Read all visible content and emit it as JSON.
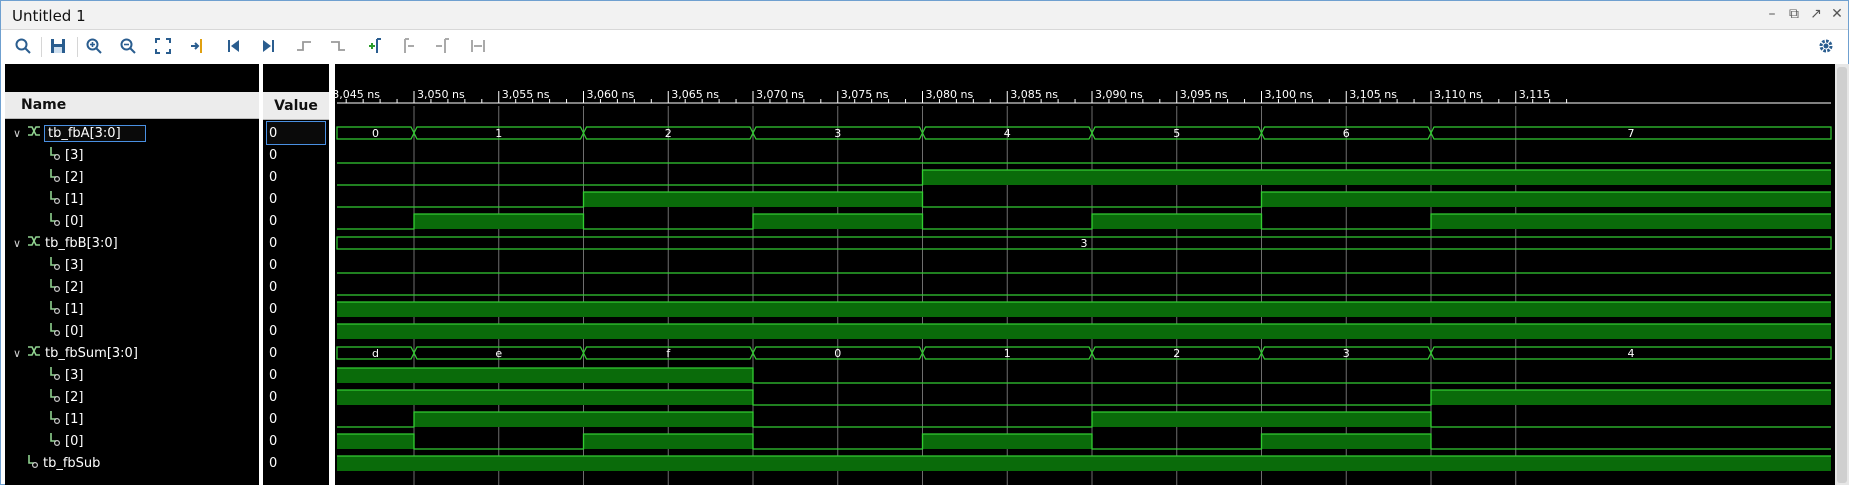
{
  "window": {
    "title": "Untitled 1"
  },
  "toolbar": {
    "icons": [
      "search-icon",
      "save-icon",
      "zoom-in-icon",
      "zoom-out-icon",
      "zoom-fit-icon",
      "go-to-cursor-icon",
      "go-to-start-icon",
      "go-to-end-icon",
      "previous-transition-icon",
      "next-transition-icon",
      "add-marker-icon",
      "previous-marker-icon",
      "next-marker-icon",
      "swap-cursors-icon",
      "settings-icon"
    ]
  },
  "columns": {
    "name": "Name",
    "value": "Value"
  },
  "signals": [
    {
      "label": "tb_fbA[3:0]",
      "type": "bus",
      "expanded": true,
      "indent": 0,
      "value": "0",
      "selected": true
    },
    {
      "label": "[3]",
      "type": "bit",
      "indent": 1,
      "value": "0"
    },
    {
      "label": "[2]",
      "type": "bit",
      "indent": 1,
      "value": "0"
    },
    {
      "label": "[1]",
      "type": "bit",
      "indent": 1,
      "value": "0"
    },
    {
      "label": "[0]",
      "type": "bit",
      "indent": 1,
      "value": "0"
    },
    {
      "label": "tb_fbB[3:0]",
      "type": "bus",
      "expanded": true,
      "indent": 0,
      "value": "0"
    },
    {
      "label": "[3]",
      "type": "bit",
      "indent": 1,
      "value": "0"
    },
    {
      "label": "[2]",
      "type": "bit",
      "indent": 1,
      "value": "0"
    },
    {
      "label": "[1]",
      "type": "bit",
      "indent": 1,
      "value": "0"
    },
    {
      "label": "[0]",
      "type": "bit",
      "indent": 1,
      "value": "0"
    },
    {
      "label": "tb_fbSum[3:0]",
      "type": "bus",
      "expanded": true,
      "indent": 0,
      "value": "0"
    },
    {
      "label": "[3]",
      "type": "bit",
      "indent": 1,
      "value": "0"
    },
    {
      "label": "[2]",
      "type": "bit",
      "indent": 1,
      "value": "0"
    },
    {
      "label": "[1]",
      "type": "bit",
      "indent": 1,
      "value": "0"
    },
    {
      "label": "[0]",
      "type": "bit",
      "indent": 1,
      "value": "0"
    },
    {
      "label": "tb_fbSub",
      "type": "bit",
      "indent": 0,
      "value": "0"
    }
  ],
  "timeline": {
    "labels": [
      "3,045 ns",
      "3,050 ns",
      "3,055 ns",
      "3,060 ns",
      "3,065 ns",
      "3,070 ns",
      "3,075 ns",
      "3,080 ns",
      "3,085 ns",
      "3,090 ns",
      "3,095 ns",
      "3,100 ns",
      "3,105 ns",
      "3,110 ns",
      "3,115"
    ]
  },
  "waves": {
    "segments_ns": [
      3050,
      3060,
      3070,
      3080,
      3090,
      3100,
      3110
    ],
    "fbA": [
      "0",
      "1",
      "2",
      "3",
      "4",
      "5",
      "6",
      "7"
    ],
    "fbA_bits": {
      "3": [
        0,
        0,
        0,
        0,
        0,
        0,
        0,
        0
      ],
      "2": [
        0,
        0,
        0,
        0,
        1,
        1,
        1,
        1
      ],
      "1": [
        0,
        0,
        1,
        1,
        0,
        0,
        1,
        1
      ],
      "0": [
        0,
        1,
        0,
        1,
        0,
        1,
        0,
        1
      ]
    },
    "fbB": [
      "3"
    ],
    "fbB_bits": {
      "3": [
        0
      ],
      "2": [
        0
      ],
      "1": [
        1
      ],
      "0": [
        1
      ]
    },
    "fbSum": [
      "d",
      "e",
      "f",
      "0",
      "1",
      "2",
      "3",
      "4"
    ],
    "fbSum_bits": {
      "3": [
        1,
        1,
        1,
        0,
        0,
        0,
        0,
        0
      ],
      "2": [
        1,
        1,
        1,
        0,
        0,
        0,
        0,
        1
      ],
      "1": [
        0,
        1,
        1,
        0,
        0,
        1,
        1,
        0
      ],
      "0": [
        1,
        0,
        1,
        0,
        1,
        0,
        1,
        0
      ]
    },
    "fbSub": [
      1
    ],
    "colors": {
      "line": "#33cc33",
      "fill": "#0a6b0a",
      "bg": "#000000",
      "grid": "#6e6e6e"
    }
  }
}
